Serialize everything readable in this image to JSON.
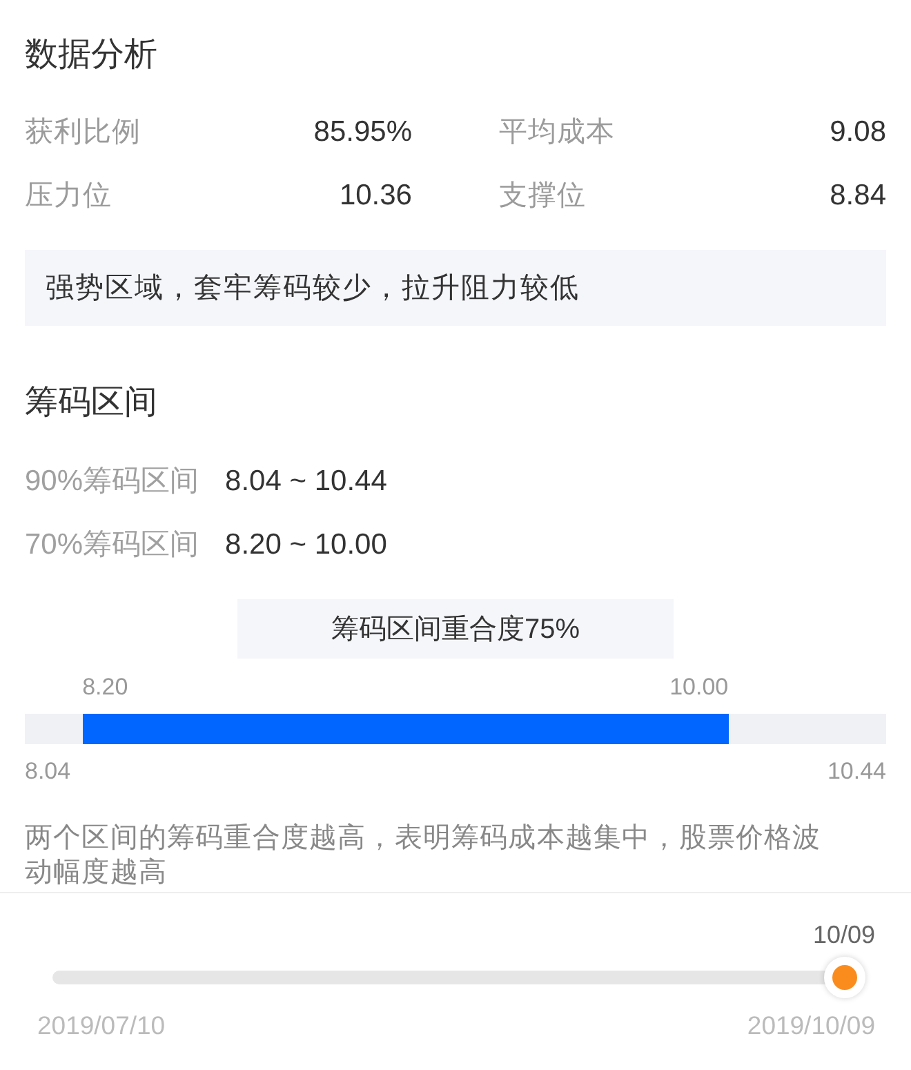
{
  "analysis": {
    "title": "数据分析",
    "metrics": [
      {
        "label": "获利比例",
        "value": "85.95%"
      },
      {
        "label": "平均成本",
        "value": "9.08"
      },
      {
        "label": "压力位",
        "value": "10.36"
      },
      {
        "label": "支撑位",
        "value": "8.84"
      }
    ],
    "summary": "强势区域，套牢筹码较少，拉升阻力较低"
  },
  "chip_range": {
    "title": "筹码区间",
    "ranges": [
      {
        "label": "90%筹码区间",
        "value": "8.04 ~ 10.44"
      },
      {
        "label": "70%筹码区间",
        "value": "8.20 ~ 10.00"
      }
    ],
    "overlap": "筹码区间重合度75%",
    "bar": {
      "inner_start": "8.20",
      "inner_end": "10.00",
      "outer_start": "8.04",
      "outer_end": "10.44"
    },
    "note": "两个区间的筹码重合度越高，表明筹码成本越集中，股票价格波动幅度越高"
  },
  "timeline": {
    "current": "10/09",
    "level": 1,
    "start": "2019/07/10",
    "end": "2019/10/09"
  }
}
